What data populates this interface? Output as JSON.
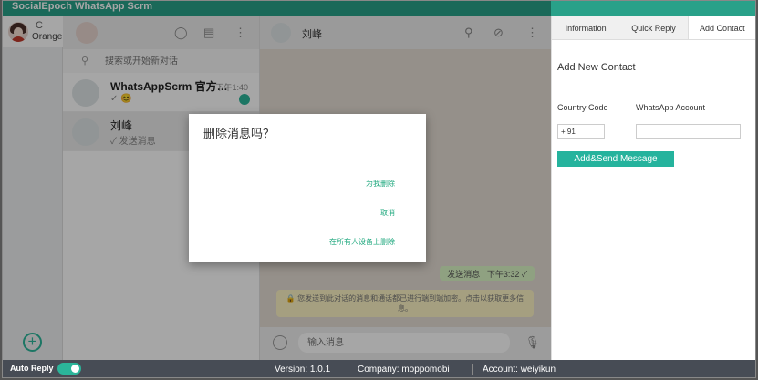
{
  "app": {
    "title": "SocialEpoch WhatsApp Scrm"
  },
  "accounts": {
    "refresh_glyph": "C",
    "active_name": "Orange",
    "add_glyph": "+"
  },
  "chatlist": {
    "search_placeholder": "搜索或开始新对话",
    "chats": [
      {
        "title": "WhatsAppScrm 官方…",
        "time": "下午1:40",
        "subtitle": "✓ 😊"
      },
      {
        "title": "刘峰",
        "time": "",
        "subtitle": "✓ 发送消息"
      }
    ]
  },
  "conversation": {
    "contact_name": "刘峰",
    "outgoing_text": "发送消息",
    "outgoing_meta": "下午3:32 ✓",
    "notice_text": "🔒 您发送到此对话的消息和通话都已进行端到端加密。点击以获取更多信息。",
    "input_placeholder": "输入消息"
  },
  "dialog": {
    "title": "删除消息吗？",
    "options": [
      "为我删除",
      "取消",
      "在所有人设备上删除"
    ]
  },
  "right_panel": {
    "tabs": [
      "Information",
      "Quick Reply",
      "Add Contact"
    ],
    "active_tab": "Add Contact",
    "heading": "Add New Contact",
    "country_code_label": "Country Code",
    "whatsapp_account_label": "WhatsApp Account",
    "country_code_value": "+ 91",
    "whatsapp_account_value": "",
    "send_button": "Add&Send Message"
  },
  "statusbar": {
    "auto_reply_label": "Auto Reply",
    "auto_reply_on": true,
    "version": "Version:  1.0.1",
    "company": "Company:  moppomobi",
    "account": "Account:  weiyikun"
  },
  "colors": {
    "brand": "#29a189",
    "accent": "#2bb59a",
    "statusbar": "#474c55"
  }
}
